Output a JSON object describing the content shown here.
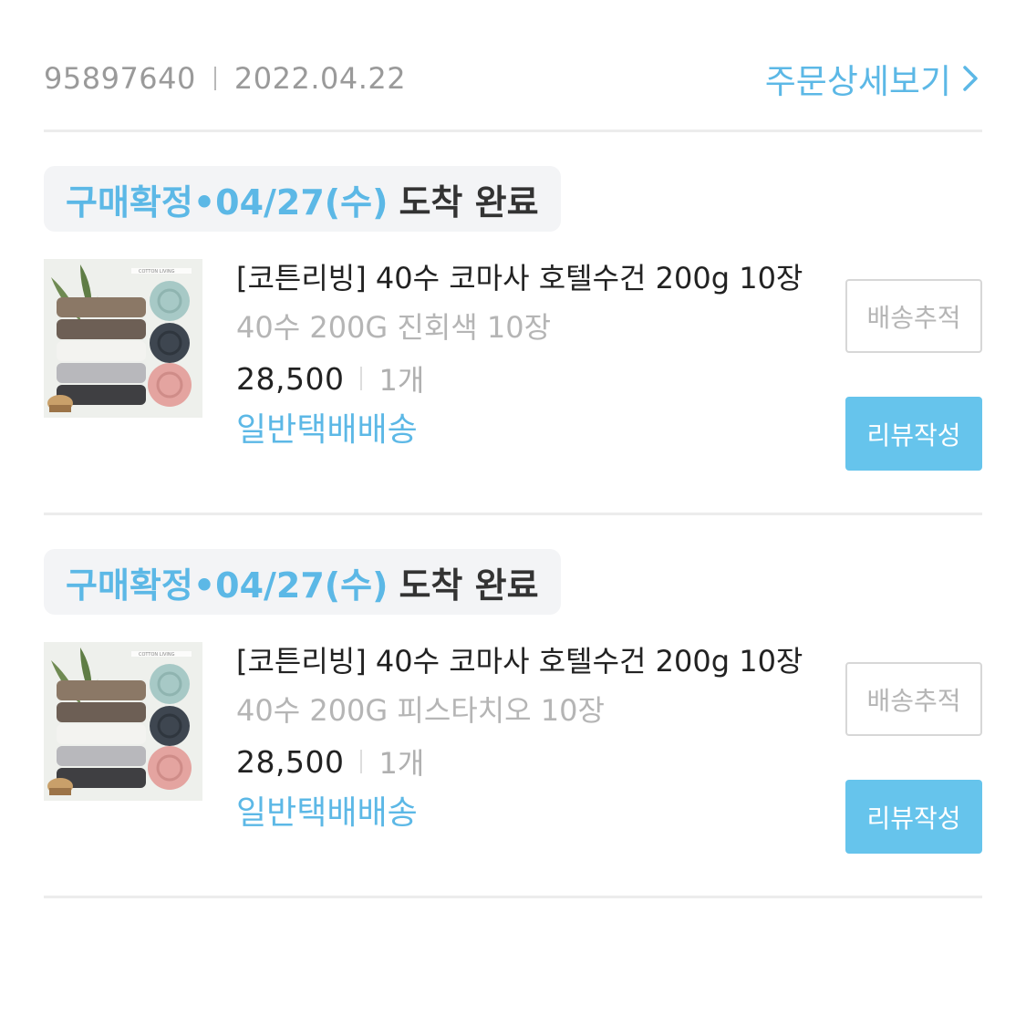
{
  "order": {
    "number": "95897640",
    "date": "2022.04.22",
    "detail_link_label": "주문상세보기"
  },
  "items": [
    {
      "status_confirm": "구매확정•04/27(수)",
      "status_arrival": "도착 완료",
      "title": "[코튼리빙] 40수 코마사 호텔수건 200g 10장",
      "option": "40수 200G 진회색 10장",
      "price": "28,500",
      "quantity": "1개",
      "shipping": "일반택배배송",
      "track_button": "배송추적",
      "review_button": "리뷰작성",
      "thumbnail_brand_text": "COTTON LIVING"
    },
    {
      "status_confirm": "구매확정•04/27(수)",
      "status_arrival": "도착 완료",
      "title": "[코튼리빙] 40수 코마사 호텔수건 200g 10장",
      "option": "40수 200G 피스타치오 10장",
      "price": "28,500",
      "quantity": "1개",
      "shipping": "일반택배배송",
      "track_button": "배송추적",
      "review_button": "리뷰작성",
      "thumbnail_brand_text": "COTTON LIVING"
    }
  ],
  "colors": {
    "accent": "#5cb8e6",
    "button_fill": "#66c4ec",
    "pill_bg": "#f3f4f6",
    "muted_text": "#9a9a9a",
    "divider": "#ececec"
  },
  "icons": {
    "detail_chevron": "chevron-right-icon"
  }
}
